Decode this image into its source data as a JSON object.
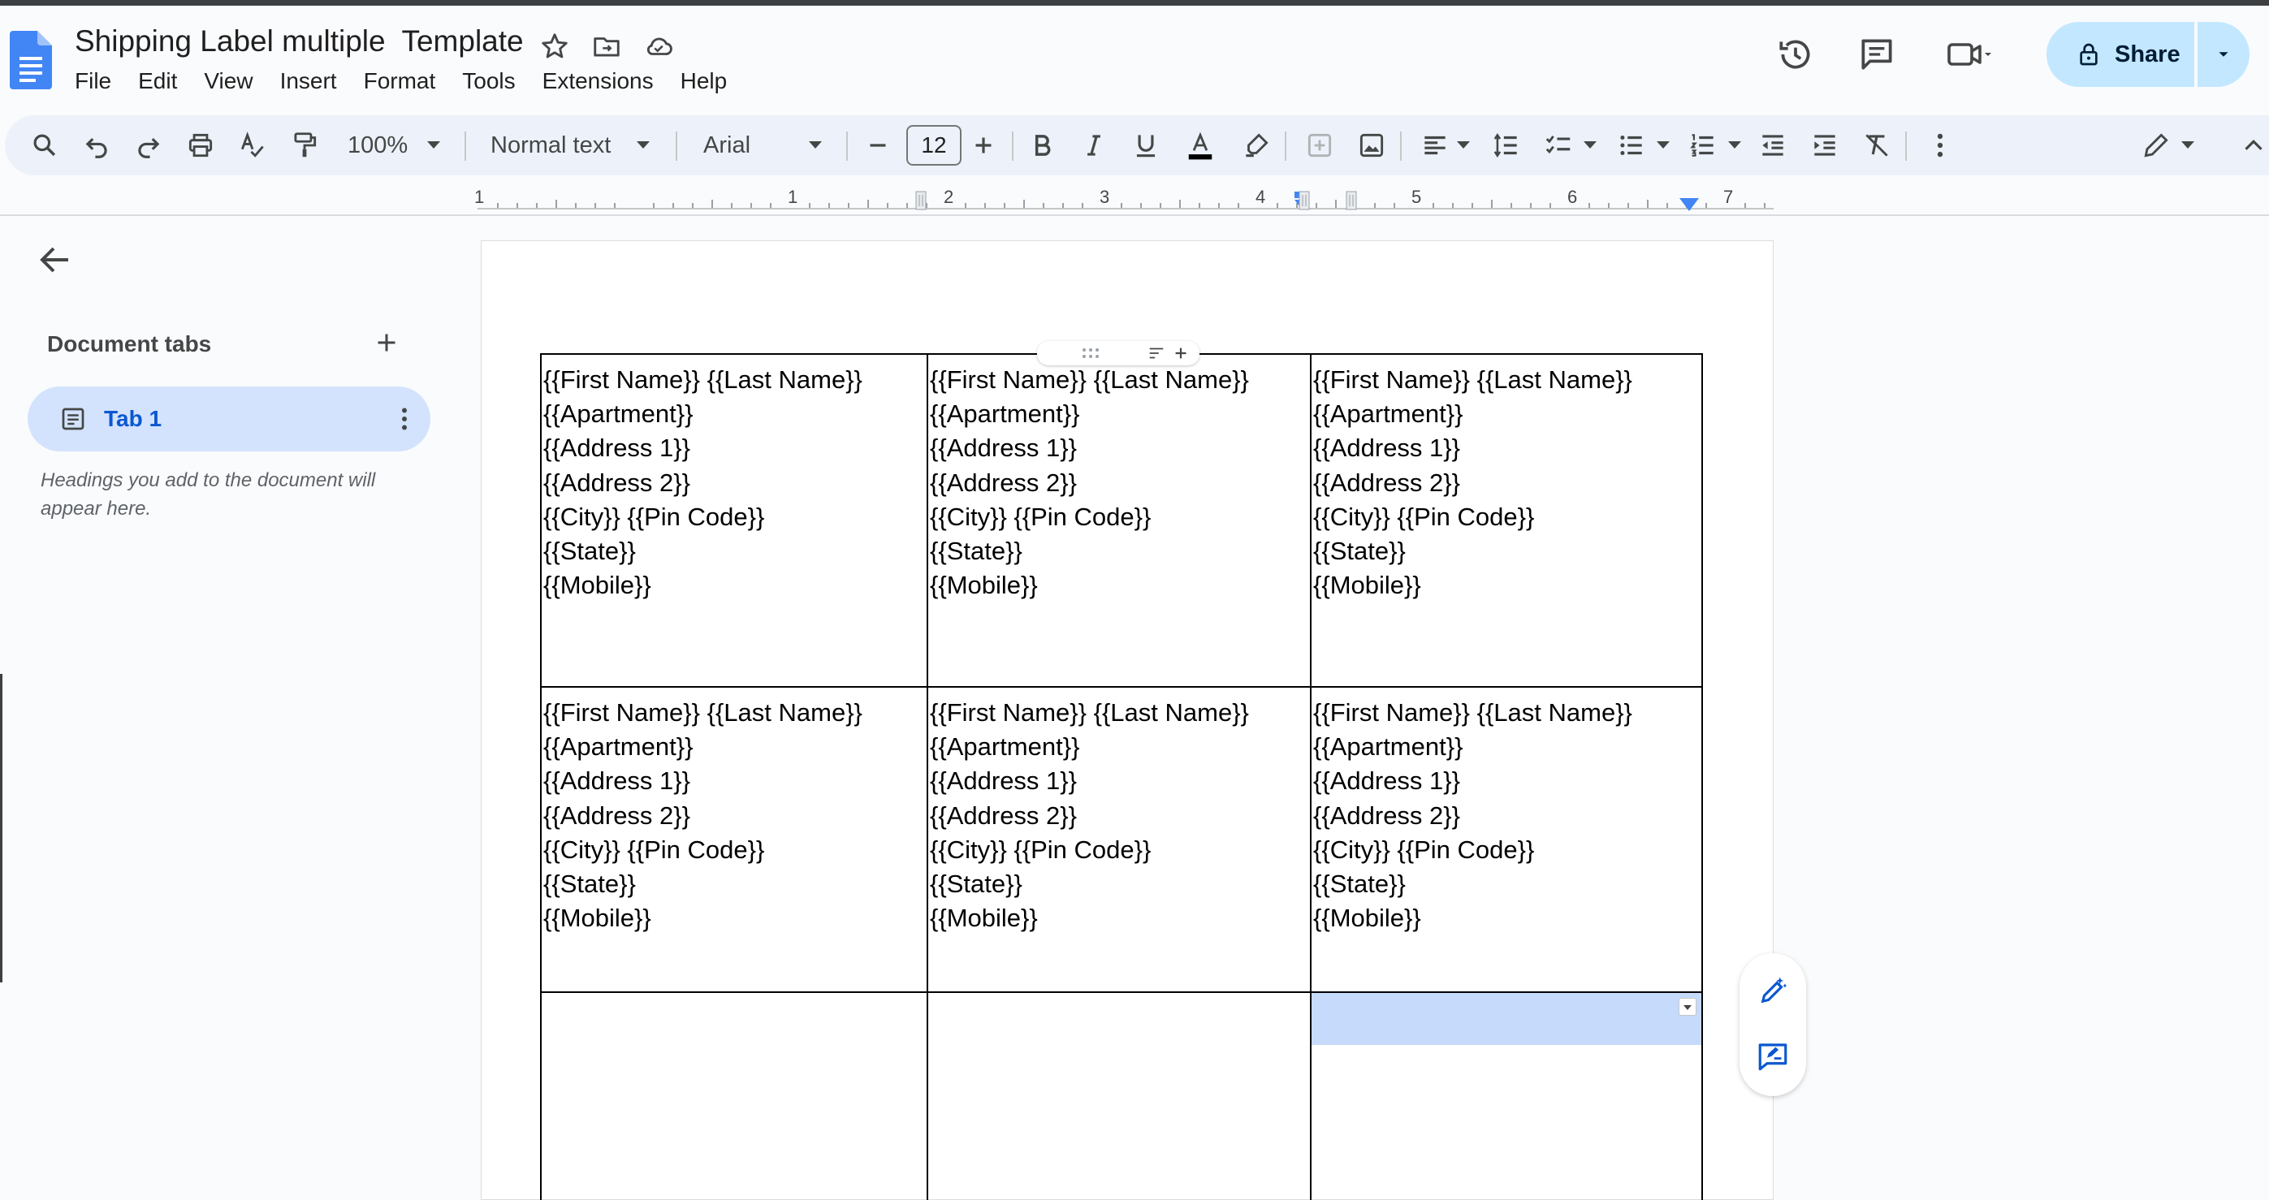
{
  "doc": {
    "title": "Shipping Label multiple  Template"
  },
  "menu": [
    "File",
    "Edit",
    "View",
    "Insert",
    "Format",
    "Tools",
    "Extensions",
    "Help"
  ],
  "header": {
    "share_label": "Share"
  },
  "toolbar": {
    "zoom": "100%",
    "style": "Normal text",
    "font": "Arial",
    "font_size": "12"
  },
  "ruler": {
    "numbers": [
      "1",
      "1",
      "2",
      "3",
      "4",
      "5",
      "6",
      "7"
    ]
  },
  "panel": {
    "heading": "Document tabs",
    "tab_label": "Tab 1",
    "hint": "Headings you add to the document will appear here."
  },
  "label_lines": [
    "{{First Name}} {{Last Name}}",
    "{{Apartment}}",
    "{{Address 1}}",
    "{{Address 2}}",
    "{{City}} {{Pin Code}}",
    "{{State}}",
    "{{Mobile}}"
  ],
  "colors": {
    "accent": "#0b57d0",
    "share_bg": "#c2e7ff",
    "tab_bg": "#d3e3fd",
    "toolbar_bg": "#edf2fa",
    "selection": "#c6dafc"
  }
}
